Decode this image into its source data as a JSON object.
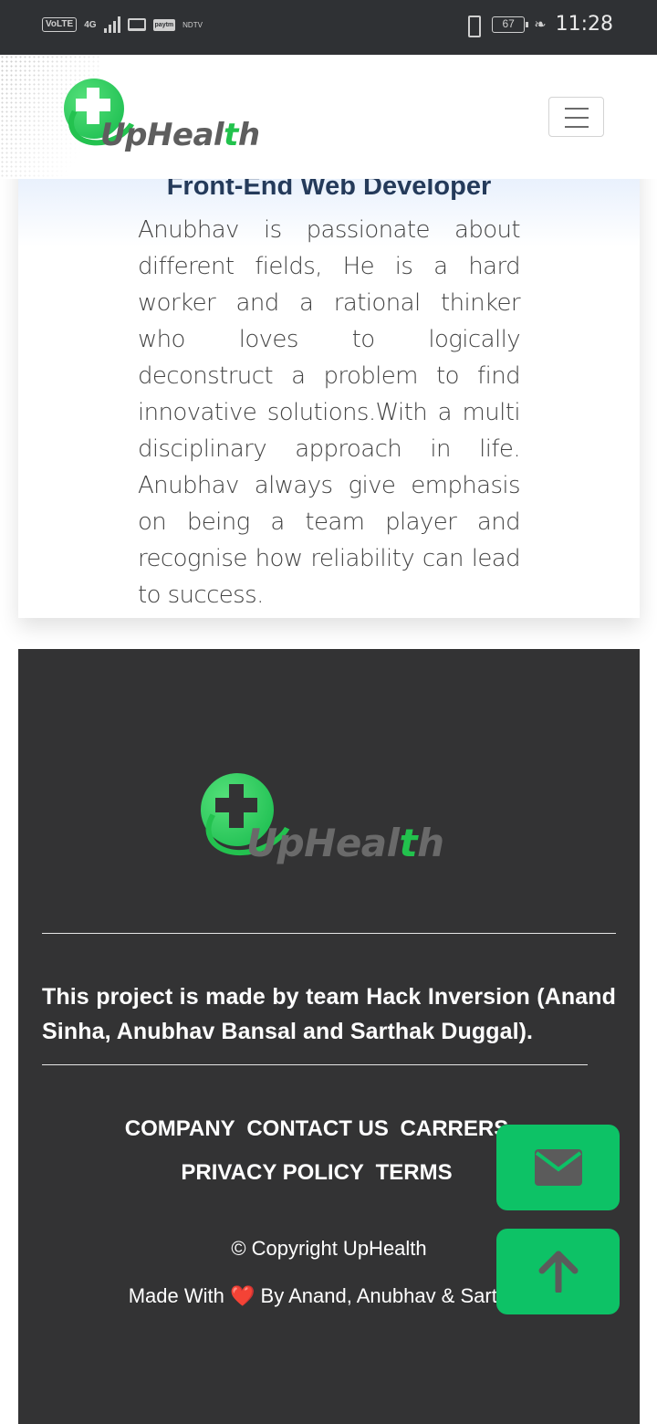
{
  "status_bar": {
    "volte": "VoLTE",
    "network": "4G",
    "battery": "67",
    "time": "11:28"
  },
  "brand": {
    "name_part1": "UpHeal",
    "name_t": "t",
    "name_part2": "h",
    "accent_color": "#22c24d"
  },
  "profile": {
    "role": "Front-End Web Developer",
    "bio": "Anubhav is passionate about different fields, He is a hard worker and a rational thinker who loves to logically deconstruct a problem to find innovative solutions.With a multi disciplinary approach in life. Anubhav always give emphasis on being a team player and recognise how reliability can lead to success."
  },
  "footer": {
    "credits": "This project is made by team Hack Inversion (Anand Sinha, Anubhav Bansal and Sarthak Duggal).",
    "links": [
      "COMPANY",
      "CONTACT US",
      "CARRERS",
      "PRIVACY POLICY",
      "TERMS"
    ],
    "copyright": "© Copyright UpHealth",
    "made_with_prefix": "Made With",
    "made_with_heart": "❤️",
    "made_with_suffix": "By Anand, Anubhav & Sarthak"
  },
  "floating_buttons": {
    "mail_icon": "envelope-icon",
    "top_icon": "arrow-up-icon",
    "color": "#0dc266"
  }
}
